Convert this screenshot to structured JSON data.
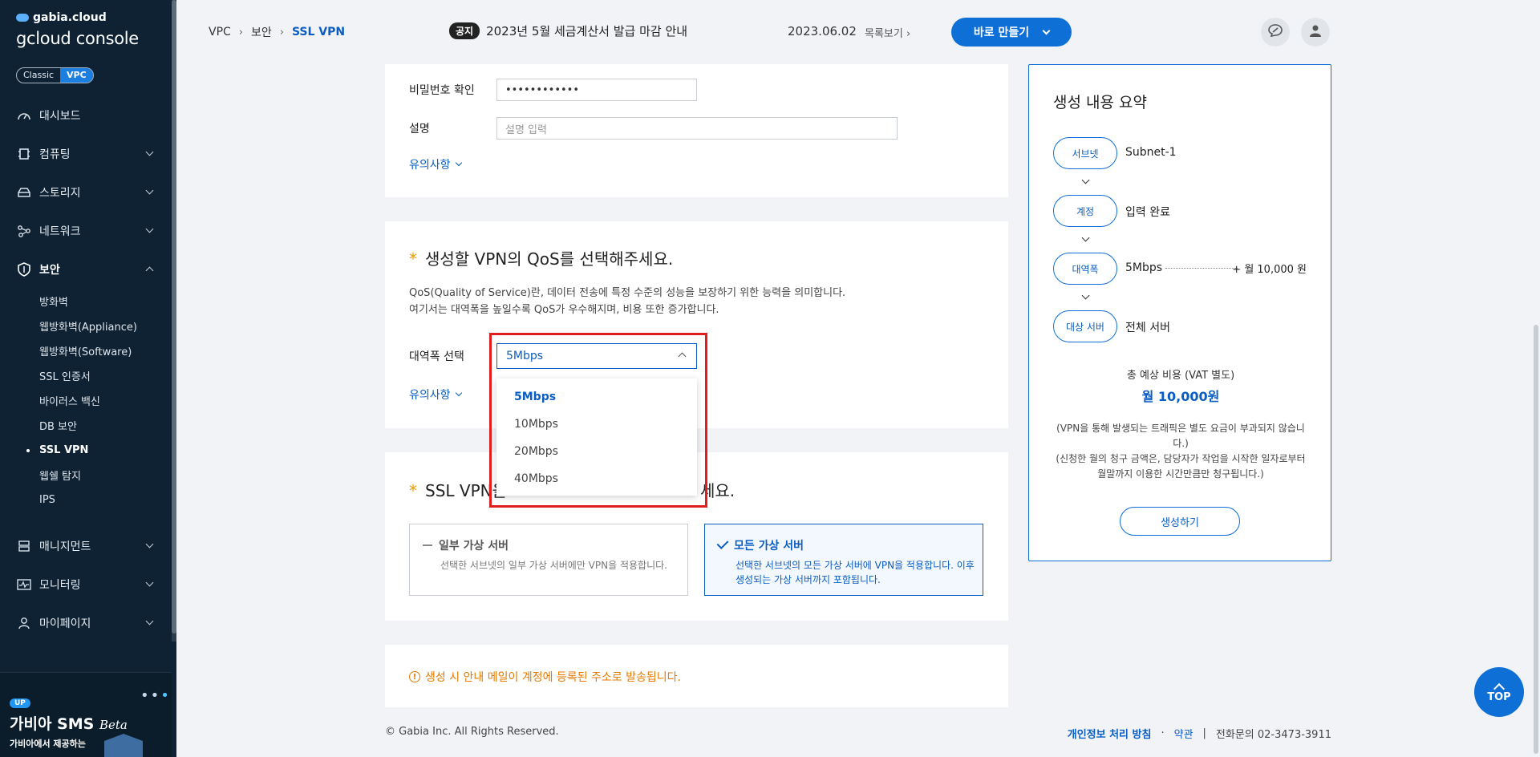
{
  "brand": {
    "small": "gabia.cloud",
    "big": "gcloud console",
    "toggle": [
      "Classic",
      "VPC"
    ]
  },
  "nav": {
    "items": [
      {
        "label": "대시보드",
        "icon": "speedometer-icon"
      },
      {
        "label": "컴퓨팅",
        "icon": "chip-icon"
      },
      {
        "label": "스토리지",
        "icon": "storage-icon"
      },
      {
        "label": "네트워크",
        "icon": "network-icon"
      },
      {
        "label": "보안",
        "icon": "shield-icon"
      }
    ],
    "sub_security": [
      "방화벽",
      "웹방화벽(Appliance)",
      "웹방화벽(Software)",
      "SSL 인증서",
      "바이러스 백신",
      "DB 보안",
      "SSL VPN",
      "웹쉘 탐지",
      "IPS"
    ],
    "items2": [
      {
        "label": "매니지먼트",
        "icon": "management-icon"
      },
      {
        "label": "모니터링",
        "icon": "monitor-icon"
      },
      {
        "label": "마이페이지",
        "icon": "user-icon"
      }
    ]
  },
  "promo": {
    "badge": "UP",
    "title": "가비아 SMS",
    "beta": "Beta",
    "sub": "가비아에서 제공하는"
  },
  "breadcrumb": [
    "VPC",
    "보안",
    "SSL VPN"
  ],
  "notice": {
    "tag": "공지",
    "text": "2023년 5월 세금계산서 발급 마감 안내",
    "date": "2023.06.02",
    "more": "목록보기"
  },
  "topbar": {
    "make_label": "바로 만들기"
  },
  "form1": {
    "pw_confirm_label": "비밀번호 확인",
    "pw_value": "••••••••••••",
    "desc_label": "설명",
    "desc_placeholder": "설명 입력",
    "notice_link": "유의사항"
  },
  "qos": {
    "title": "생성할 VPN의 QoS를 선택해주세요.",
    "desc1": "QoS(Quality of Service)란, 데이터 전송에 특정 수준의 성능을 보장하기 위한 능력을 의미합니다.",
    "desc2": "여기서는 대역폭을 높일수록 QoS가 우수해지며, 비용 또한 증가합니다.",
    "bw_label": "대역폭 선택",
    "selected": "5Mbps",
    "options": [
      "5Mbps",
      "10Mbps",
      "20Mbps",
      "40Mbps"
    ],
    "notice_link": "유의사항"
  },
  "server": {
    "title_left": "SSL VPN을",
    "title_right": "세요.",
    "partial_title": "일부 가상 서버",
    "partial_desc": "선택한 서브넷의 일부 가상 서버에만 VPN을 적용합니다.",
    "all_title": "모든 가상 서버",
    "all_desc": "선택한 서브넷의 모든 가상 서버에 VPN을 적용합니다. 이후 생성되는 가상 서버까지 포함됩니다."
  },
  "info_text": "생성 시 안내 메일이 계정에 등록된 주소로 발송됩니다.",
  "summary": {
    "title": "생성 내용 요약",
    "rows": [
      {
        "pill": "서브넷",
        "value": "Subnet-1"
      },
      {
        "pill": "계정",
        "value": "입력 완료"
      },
      {
        "pill": "대역폭",
        "value": "5Mbps"
      },
      {
        "pill": "대상 서버",
        "value": "전체 서버"
      }
    ],
    "price": "+ 월 10,000 원",
    "total_label": "총 예상 비용 (VAT 별도)",
    "total_value": "월 10,000원",
    "note1": "(VPN을 통해 발생되는 트래픽은 별도 요금이 부과되지 않습니다.)",
    "note2": "(신청한 월의 청구 금액은, 담당자가 작업을 시작한 일자로부터 월말까지 이용한 시간만큼만 청구됩니다.)",
    "create_label": "생성하기"
  },
  "footer": {
    "copyright": "© Gabia Inc. All Rights Reserved.",
    "privacy": "개인정보 처리 방침",
    "terms": "약관",
    "contact": "전화문의  02-3473-3911"
  },
  "top_label": "TOP"
}
